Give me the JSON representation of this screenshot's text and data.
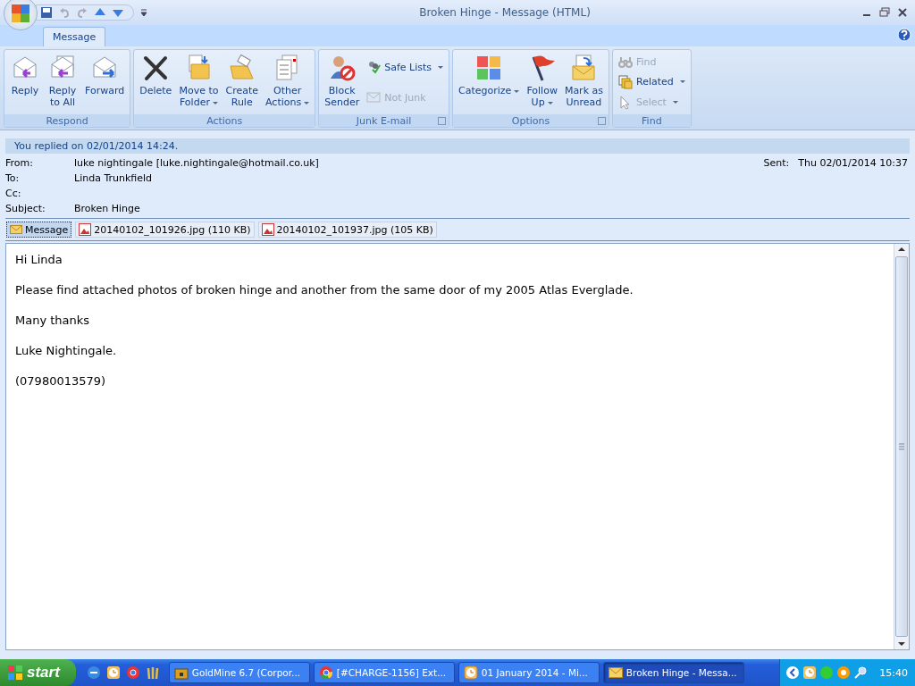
{
  "window": {
    "title": "Broken Hinge - Message (HTML)"
  },
  "tabs": [
    {
      "label": "Message",
      "selected": true
    }
  ],
  "ribbon": {
    "groups": [
      {
        "label": "Respond",
        "launcher": false,
        "buttons": [
          {
            "kind": "large",
            "label": "Reply",
            "dropdown": false,
            "disabled": false
          },
          {
            "kind": "large",
            "label": "Reply\nto All",
            "dropdown": false,
            "disabled": false
          },
          {
            "kind": "large",
            "label": "Forward",
            "dropdown": false,
            "disabled": false
          }
        ]
      },
      {
        "label": "Actions",
        "launcher": false,
        "buttons": [
          {
            "kind": "large",
            "label": "Delete",
            "dropdown": false,
            "disabled": false
          },
          {
            "kind": "large",
            "label": "Move to\nFolder",
            "dropdown": true,
            "disabled": false
          },
          {
            "kind": "large",
            "label": "Create\nRule",
            "dropdown": false,
            "disabled": false
          },
          {
            "kind": "large",
            "label": "Other\nActions",
            "dropdown": true,
            "disabled": false
          }
        ]
      },
      {
        "label": "Junk E-mail",
        "launcher": true,
        "buttons": [
          {
            "kind": "large",
            "label": "Block\nSender",
            "dropdown": false,
            "disabled": false
          },
          {
            "kind": "small",
            "label": "Safe Lists",
            "dropdown": true,
            "disabled": false
          },
          {
            "kind": "small",
            "label": "Not Junk",
            "dropdown": false,
            "disabled": true
          }
        ]
      },
      {
        "label": "Options",
        "launcher": true,
        "buttons": [
          {
            "kind": "large",
            "label": "Categorize",
            "dropdown": true,
            "disabled": false
          },
          {
            "kind": "large",
            "label": "Follow\nUp",
            "dropdown": true,
            "disabled": false
          },
          {
            "kind": "large",
            "label": "Mark as\nUnread",
            "dropdown": false,
            "disabled": false
          }
        ]
      },
      {
        "label": "Find",
        "launcher": false,
        "buttons": [
          {
            "kind": "small",
            "label": "Find",
            "dropdown": false,
            "disabled": true
          },
          {
            "kind": "small",
            "label": "Related",
            "dropdown": true,
            "disabled": false
          },
          {
            "kind": "small",
            "label": "Select",
            "dropdown": true,
            "disabled": true
          }
        ]
      }
    ]
  },
  "info_bar": "You replied on 02/01/2014 14:24.",
  "header": {
    "fields": [
      {
        "label": "From:",
        "value": "luke nightingale [luke.nightingale@hotmail.co.uk]"
      },
      {
        "label": "To:",
        "value": "Linda Trunkfield"
      },
      {
        "label": "Cc:"
      },
      {
        "label": "Subject:",
        "value": "Broken Hinge"
      }
    ],
    "sent_label": "Sent:",
    "sent_value": "Thu 02/01/2014 10:37"
  },
  "attachments": [
    {
      "kind": "message",
      "label": "Message",
      "selected": true
    },
    {
      "kind": "file",
      "label": "20140102_101926.jpg (110 KB)",
      "selected": false
    },
    {
      "kind": "file",
      "label": "20140102_101937.jpg (105 KB)",
      "selected": false
    }
  ],
  "body": [
    "Hi Linda",
    "Please find attached photos of broken hinge and another from the same door of my 2005 Atlas Everglade.",
    "Many thanks",
    "Luke Nightingale.",
    "(07980013579)"
  ],
  "taskbar": {
    "start": "start",
    "tasks": [
      {
        "kind": "goldmine",
        "label": "GoldMine 6.7 (Corpor...",
        "selected": false
      },
      {
        "kind": "browser",
        "label": "[#CHARGE-1156] Ext...",
        "selected": false
      },
      {
        "kind": "calendar",
        "label": "01 January 2014 - Mi...",
        "selected": false
      },
      {
        "kind": "mail",
        "label": "Broken Hinge - Messa...",
        "selected": true
      }
    ],
    "clock": "15:40"
  }
}
